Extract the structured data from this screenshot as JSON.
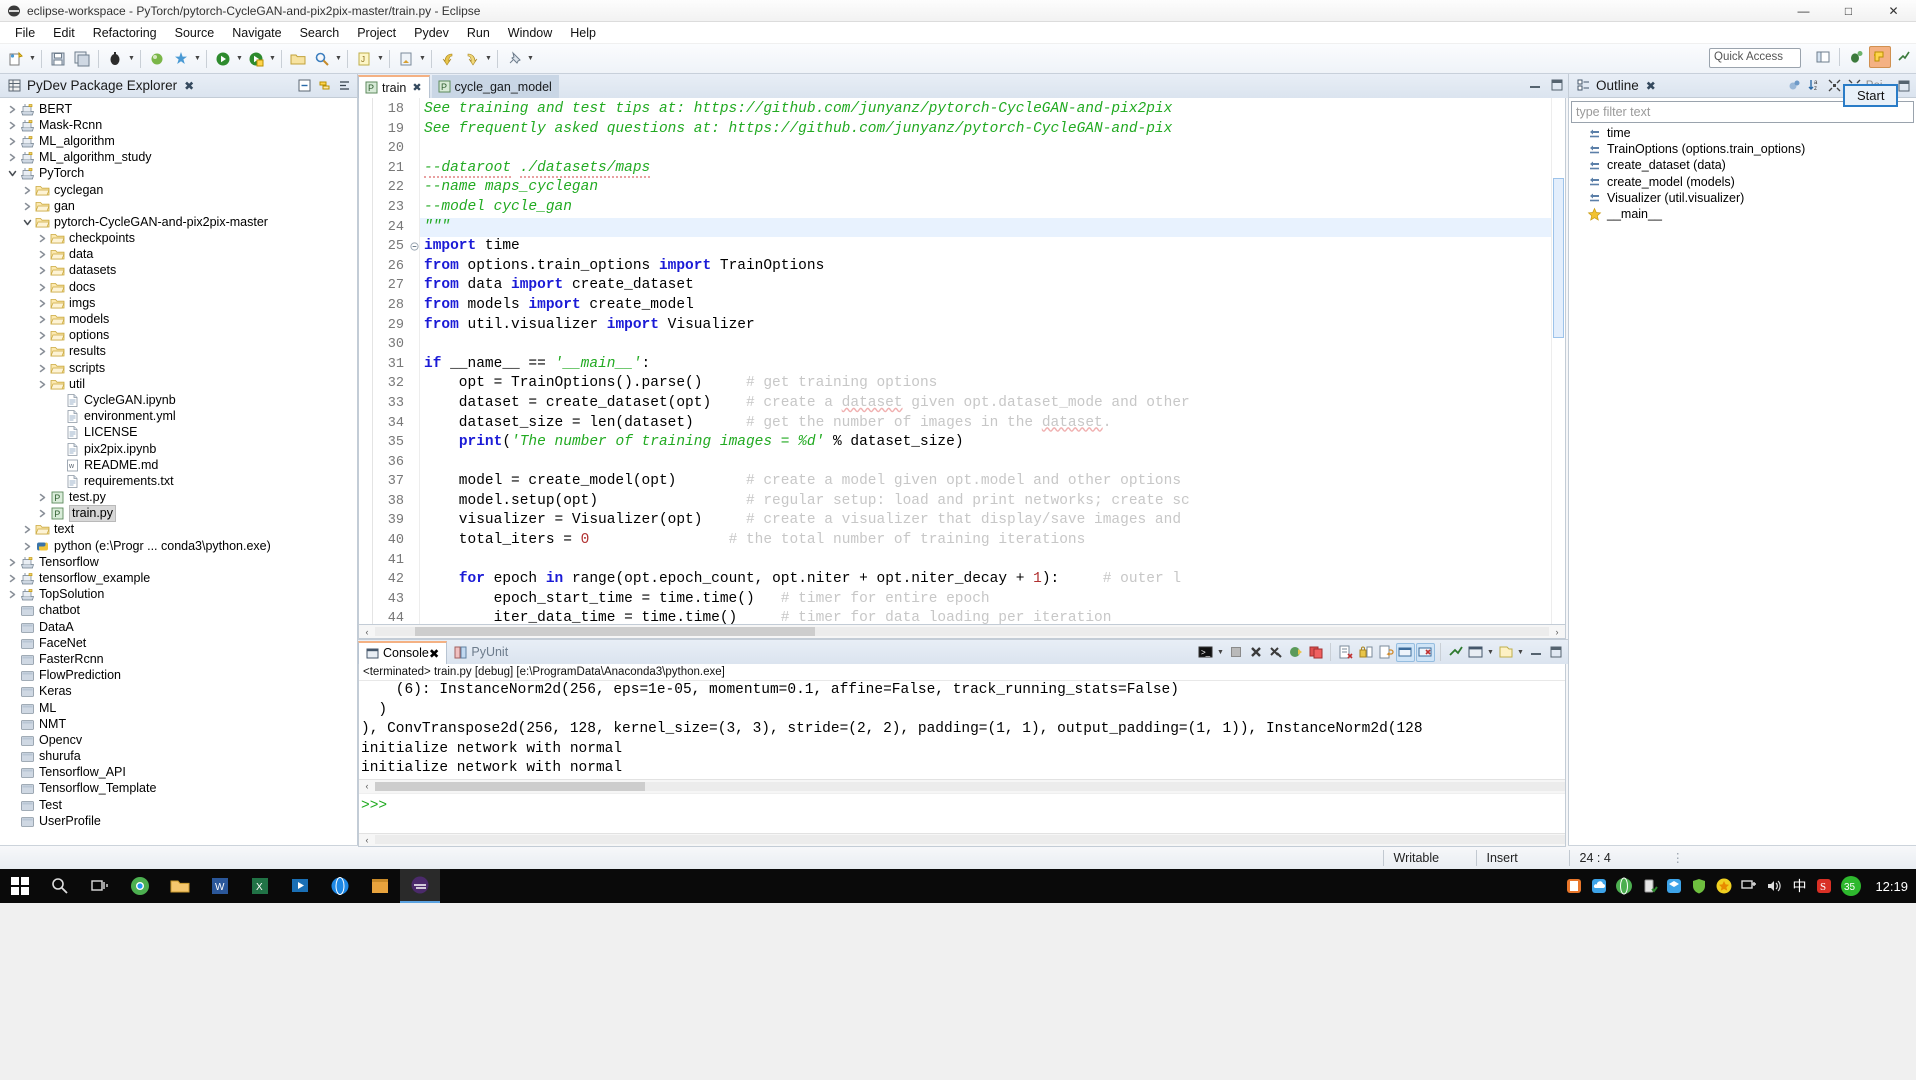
{
  "window": {
    "title": "eclipse-workspace - PyTorch/pytorch-CycleGAN-and-pix2pix-master/train.py - Eclipse",
    "minimize": "—",
    "maximize": "□",
    "close": "✕"
  },
  "menu": [
    "File",
    "Edit",
    "Refactoring",
    "Source",
    "Navigate",
    "Search",
    "Project",
    "Pydev",
    "Run",
    "Window",
    "Help"
  ],
  "toolbar": {
    "quick_access_placeholder": "Quick Access"
  },
  "package_explorer": {
    "title": "PyDev Package Explorer",
    "close_glyph": "✖",
    "items": [
      {
        "label": "BERT",
        "indent": 0,
        "arrow": "collapsed",
        "icon": "project-icon"
      },
      {
        "label": "Mask-Rcnn",
        "indent": 0,
        "arrow": "collapsed",
        "icon": "project-icon"
      },
      {
        "label": "ML_algorithm",
        "indent": 0,
        "arrow": "collapsed",
        "icon": "project-icon"
      },
      {
        "label": "ML_algorithm_study",
        "indent": 0,
        "arrow": "collapsed",
        "icon": "project-icon"
      },
      {
        "label": "PyTorch",
        "indent": 0,
        "arrow": "expanded",
        "icon": "project-icon"
      },
      {
        "label": "cyclegan",
        "indent": 1,
        "arrow": "collapsed",
        "icon": "folder-icon"
      },
      {
        "label": "gan",
        "indent": 1,
        "arrow": "collapsed",
        "icon": "folder-icon"
      },
      {
        "label": "pytorch-CycleGAN-and-pix2pix-master",
        "indent": 1,
        "arrow": "expanded",
        "icon": "folder-icon"
      },
      {
        "label": "checkpoints",
        "indent": 2,
        "arrow": "collapsed",
        "icon": "folder-icon"
      },
      {
        "label": "data",
        "indent": 2,
        "arrow": "collapsed",
        "icon": "folder-icon"
      },
      {
        "label": "datasets",
        "indent": 2,
        "arrow": "collapsed",
        "icon": "folder-icon"
      },
      {
        "label": "docs",
        "indent": 2,
        "arrow": "collapsed",
        "icon": "folder-icon"
      },
      {
        "label": "imgs",
        "indent": 2,
        "arrow": "collapsed",
        "icon": "folder-icon"
      },
      {
        "label": "models",
        "indent": 2,
        "arrow": "collapsed",
        "icon": "folder-icon"
      },
      {
        "label": "options",
        "indent": 2,
        "arrow": "collapsed",
        "icon": "folder-icon"
      },
      {
        "label": "results",
        "indent": 2,
        "arrow": "collapsed",
        "icon": "folder-icon"
      },
      {
        "label": "scripts",
        "indent": 2,
        "arrow": "collapsed",
        "icon": "folder-icon"
      },
      {
        "label": "util",
        "indent": 2,
        "arrow": "collapsed",
        "icon": "folder-icon"
      },
      {
        "label": "CycleGAN.ipynb",
        "indent": 3,
        "arrow": "none",
        "icon": "file-icon"
      },
      {
        "label": "environment.yml",
        "indent": 3,
        "arrow": "none",
        "icon": "file-icon"
      },
      {
        "label": "LICENSE",
        "indent": 3,
        "arrow": "none",
        "icon": "file-icon"
      },
      {
        "label": "pix2pix.ipynb",
        "indent": 3,
        "arrow": "none",
        "icon": "file-icon"
      },
      {
        "label": "README.md",
        "indent": 3,
        "arrow": "none",
        "icon": "markdown-icon"
      },
      {
        "label": "requirements.txt",
        "indent": 3,
        "arrow": "none",
        "icon": "file-icon"
      },
      {
        "label": "test.py",
        "indent": 2,
        "arrow": "collapsed",
        "icon": "python-icon"
      },
      {
        "label": "train.py",
        "indent": 2,
        "arrow": "collapsed",
        "icon": "python-icon",
        "selected": true
      },
      {
        "label": "text",
        "indent": 1,
        "arrow": "collapsed",
        "icon": "folder-icon"
      },
      {
        "label": "python  (e:\\Progr ... conda3\\python.exe)",
        "indent": 1,
        "arrow": "collapsed",
        "icon": "python-interp-icon"
      },
      {
        "label": "Tensorflow",
        "indent": 0,
        "arrow": "collapsed",
        "icon": "project-icon"
      },
      {
        "label": "tensorflow_example",
        "indent": 0,
        "arrow": "collapsed",
        "icon": "project-icon"
      },
      {
        "label": "TopSolution",
        "indent": 0,
        "arrow": "collapsed",
        "icon": "project-icon"
      },
      {
        "label": "chatbot",
        "indent": 0,
        "arrow": "none",
        "icon": "closed-project-icon"
      },
      {
        "label": "DataA",
        "indent": 0,
        "arrow": "none",
        "icon": "closed-project-icon"
      },
      {
        "label": "FaceNet",
        "indent": 0,
        "arrow": "none",
        "icon": "closed-project-icon"
      },
      {
        "label": "FasterRcnn",
        "indent": 0,
        "arrow": "none",
        "icon": "closed-project-icon"
      },
      {
        "label": "FlowPrediction",
        "indent": 0,
        "arrow": "none",
        "icon": "closed-project-icon"
      },
      {
        "label": "Keras",
        "indent": 0,
        "arrow": "none",
        "icon": "closed-project-icon"
      },
      {
        "label": "ML",
        "indent": 0,
        "arrow": "none",
        "icon": "closed-project-icon"
      },
      {
        "label": "NMT",
        "indent": 0,
        "arrow": "none",
        "icon": "closed-project-icon"
      },
      {
        "label": "Opencv",
        "indent": 0,
        "arrow": "none",
        "icon": "closed-project-icon"
      },
      {
        "label": "shurufa",
        "indent": 0,
        "arrow": "none",
        "icon": "closed-project-icon"
      },
      {
        "label": "Tensorflow_API",
        "indent": 0,
        "arrow": "none",
        "icon": "closed-project-icon"
      },
      {
        "label": "Tensorflow_Template",
        "indent": 0,
        "arrow": "none",
        "icon": "closed-project-icon"
      },
      {
        "label": "Test",
        "indent": 0,
        "arrow": "none",
        "icon": "closed-project-icon"
      },
      {
        "label": "UserProfile",
        "indent": 0,
        "arrow": "none",
        "icon": "closed-project-icon"
      }
    ]
  },
  "editor": {
    "tabs": [
      {
        "label": "train",
        "active": true,
        "closable": true
      },
      {
        "label": "cycle_gan_model",
        "active": false,
        "closable": false
      }
    ],
    "first_line_number": 18,
    "lines": [
      {
        "n": 18,
        "html": "<span class='doc'>See training and test tips at: https://github.com/junyanz/pytorch-CycleGAN-and-pix2pix</span>"
      },
      {
        "n": 19,
        "html": "<span class='doc'>See frequently asked questions at: https://github.com/junyanz/pytorch-CycleGAN-and-pix</span>"
      },
      {
        "n": 20,
        "html": ""
      },
      {
        "n": 21,
        "html": "<span class='doc'><span class='wavy'>--dataroot</span> <span class='wavy'>./datasets/maps</span></span>"
      },
      {
        "n": 22,
        "html": "<span class='doc'>--name maps_cyclegan</span>"
      },
      {
        "n": 23,
        "html": "<span class='doc'>--model cycle_gan</span>"
      },
      {
        "n": 24,
        "html": "<span class='doc'>\"\"\"</span>",
        "highlight": true
      },
      {
        "n": 25,
        "html": "<span class='kw'>import</span> time",
        "fold": true
      },
      {
        "n": 26,
        "html": "<span class='kw'>from</span> options.train_options <span class='kw'>import</span> TrainOptions"
      },
      {
        "n": 27,
        "html": "<span class='kw'>from</span> data <span class='kw'>import</span> create_dataset"
      },
      {
        "n": 28,
        "html": "<span class='kw'>from</span> models <span class='kw'>import</span> create_model"
      },
      {
        "n": 29,
        "html": "<span class='kw'>from</span> util.visualizer <span class='kw'>import</span> Visualizer"
      },
      {
        "n": 30,
        "html": ""
      },
      {
        "n": 31,
        "html": "<span class='kw'>if</span> __name__ == <span class='str'>'__main__'</span>:"
      },
      {
        "n": 32,
        "html": "    opt = TrainOptions().parse()     <span class='cmt'># get training options</span>"
      },
      {
        "n": 33,
        "html": "    dataset = create_dataset(opt)    <span class='cmt'># create a <u>dataset</u> given opt.dataset_mode and other</span>"
      },
      {
        "n": 34,
        "html": "    dataset_size = len(dataset)      <span class='cmt'># get the number of images in the <u>dataset</u>.</span>"
      },
      {
        "n": 35,
        "html": "    <span class='fn'>print</span>(<span class='str'>'The number of training images = %d'</span> % dataset_size)"
      },
      {
        "n": 36,
        "html": ""
      },
      {
        "n": 37,
        "html": "    model = create_model(opt)        <span class='cmt'># create a model given opt.model and other options</span>"
      },
      {
        "n": 38,
        "html": "    model.setup(opt)                 <span class='cmt'># regular setup: load and print networks; create sc</span>"
      },
      {
        "n": 39,
        "html": "    visualizer = Visualizer(opt)     <span class='cmt'># create a visualizer that display/save images and</span>"
      },
      {
        "n": 40,
        "html": "    total_iters = <span class='num'>0</span>                <span class='cmt'># the total number of training iterations</span>"
      },
      {
        "n": 41,
        "html": ""
      },
      {
        "n": 42,
        "html": "    <span class='kw'>for</span> epoch <span class='kw'>in</span> range(opt.epoch_count, opt.niter + opt.niter_decay + <span class='num'>1</span>):     <span class='cmt'># outer l</span>"
      },
      {
        "n": 43,
        "html": "        epoch_start_time = time.time()   <span class='cmt'># timer for entire epoch</span>"
      },
      {
        "n": 44,
        "html": "        iter_data_time = time.time()     <span class='cmt'># timer for data loading per iteration</span>"
      }
    ]
  },
  "console": {
    "tabs": [
      {
        "label": "Console",
        "active": true
      },
      {
        "label": "PyUnit",
        "active": false
      }
    ],
    "process_line": "<terminated> train.py [debug] [e:\\ProgramData\\Anaconda3\\python.exe]",
    "output": [
      "    (6): InstanceNorm2d(256, eps=1e-05, momentum=0.1, affine=False, track_running_stats=False)",
      "  )",
      "), ConvTranspose2d(256, 128, kernel_size=(3, 3), stride=(2, 2), padding=(1, 1), output_padding=(1, 1)), InstanceNorm2d(128",
      "initialize network with normal",
      "initialize network with normal"
    ],
    "prompt": ">>>"
  },
  "outline": {
    "title": "Outline",
    "close_glyph": "✖",
    "filter_placeholder": "type filter text",
    "pinned_label": "Poi...",
    "tooltip": "Start",
    "items": [
      {
        "label": "time",
        "icon": "import-icon"
      },
      {
        "label": "TrainOptions (options.train_options)",
        "icon": "import-icon"
      },
      {
        "label": "create_dataset (data)",
        "icon": "import-icon"
      },
      {
        "label": "create_model (models)",
        "icon": "import-icon"
      },
      {
        "label": "Visualizer (util.visualizer)",
        "icon": "import-icon"
      },
      {
        "label": "__main__",
        "icon": "main-icon"
      }
    ]
  },
  "statusbar": {
    "writable": "Writable",
    "insert": "Insert",
    "position": "24 : 4"
  },
  "taskbar": {
    "clock": "12:19",
    "ime": "中",
    "badge": "35"
  },
  "colors": {
    "accent": "#2a7cc7",
    "tab_active_top": "#f4b183",
    "comment": "#c7c7c7",
    "string": "#22aa22",
    "keyword": "#1a1ad6"
  }
}
